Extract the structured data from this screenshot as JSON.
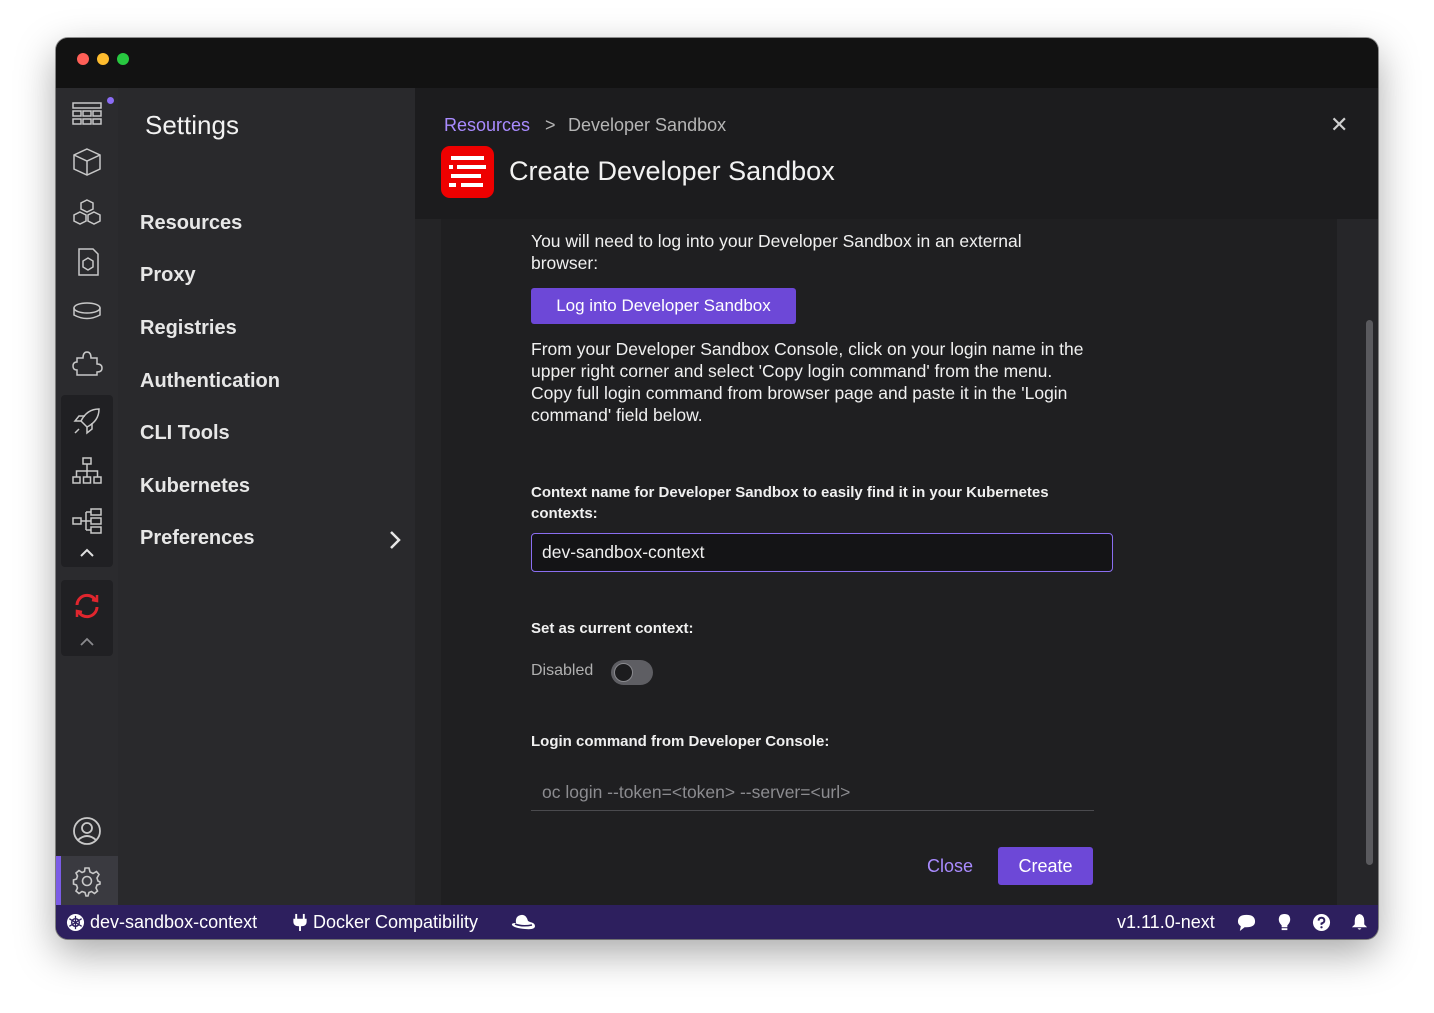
{
  "settings": {
    "title": "Settings",
    "items": [
      "Resources",
      "Proxy",
      "Registries",
      "Authentication",
      "CLI Tools",
      "Kubernetes",
      "Preferences"
    ]
  },
  "header": {
    "breadcrumb_link": "Resources",
    "breadcrumb_separator": ">",
    "breadcrumb_current": "Developer Sandbox",
    "title": "Create Developer Sandbox",
    "close_symbol": "✕"
  },
  "form": {
    "intro": "You will need to log into your Developer Sandbox in an external browser:",
    "login_button": "Log into Developer Sandbox",
    "instructions": "From your Developer Sandbox Console, click on your login name in the upper right corner and select 'Copy login command' from the menu. Copy full login command from browser page and paste it in the 'Login command' field below.",
    "context_label": "Context name for Developer Sandbox to easily find it in your Kubernetes contexts:",
    "context_value": "dev-sandbox-context",
    "current_context_label": "Set as current context:",
    "toggle_state": "Disabled",
    "toggle_on": false,
    "login_command_label": "Login command from Developer Console:",
    "login_command_value": "",
    "login_command_placeholder": "oc login --token=<token> --server=<url>",
    "close_button": "Close",
    "create_button": "Create"
  },
  "statusbar": {
    "context": "dev-sandbox-context",
    "compat": "Docker Compatibility",
    "version": "v1.11.0-next"
  },
  "colors": {
    "accent": "#6d48d7",
    "accent_text": "#a98bff",
    "statusbar": "#2d1f5e",
    "brand_red": "#ee0000"
  }
}
